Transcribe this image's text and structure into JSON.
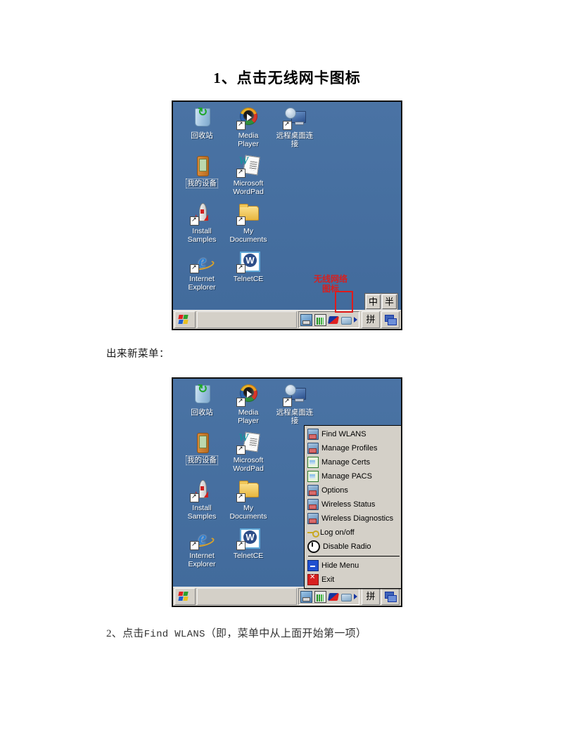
{
  "document": {
    "title": "1、点击无线网卡图标",
    "para_after_first": "出来新菜单：",
    "para_bottom_prefix": "2、点击",
    "para_bottom_mono": "Find WLANS",
    "para_bottom_suffix": "（即，菜单中从上面开始第一项）"
  },
  "colors": {
    "desktop_blue": "#46709f",
    "taskbar_gray": "#d4d0c8",
    "annotation_red": "#d71f1f",
    "menu_bg": "#d4d0c8"
  },
  "desktop": {
    "icons": [
      {
        "label": "回收站",
        "icon": "recycle-bin-icon",
        "shortcut": false,
        "selected": false
      },
      {
        "label": "Media\nPlayer",
        "icon": "media-player-icon",
        "shortcut": true,
        "selected": false
      },
      {
        "label": "远程桌面连\n接",
        "icon": "remote-desktop-icon",
        "shortcut": true,
        "selected": false
      },
      {
        "label": "我的设备",
        "icon": "my-device-icon",
        "shortcut": false,
        "selected": true
      },
      {
        "label": "Microsoft\nWordPad",
        "icon": "wordpad-icon",
        "shortcut": true,
        "selected": false
      },
      {
        "label": "Install\nSamples",
        "icon": "install-samples-icon",
        "shortcut": true,
        "selected": false
      },
      {
        "label": "My\nDocuments",
        "icon": "my-documents-icon",
        "shortcut": true,
        "selected": false
      },
      {
        "label": "Internet\nExplorer",
        "icon": "internet-explorer-icon",
        "shortcut": true,
        "selected": false
      },
      {
        "label": "TelnetCE",
        "icon": "telnetce-icon",
        "shortcut": true,
        "selected": false
      }
    ]
  },
  "annotation": {
    "text": "无线网络\n图标"
  },
  "ime_float": {
    "keys": [
      "中",
      "半"
    ]
  },
  "taskbar": {
    "start_button": "start-button",
    "tray_icons": [
      "network-icon",
      "signal-bars-icon",
      "wireless-icon",
      "connection-icon"
    ],
    "tray_overflow": "▶",
    "ime_label": "拼",
    "switch_label": "task-switch-icon"
  },
  "context_menu": {
    "items": [
      {
        "label": "Find WLANS",
        "icon": "find-wlans-icon",
        "type": "item"
      },
      {
        "label": "Manage Profiles",
        "icon": "manage-profiles-icon",
        "type": "item"
      },
      {
        "label": "Manage Certs",
        "icon": "manage-certs-icon",
        "type": "item"
      },
      {
        "label": "Manage PACS",
        "icon": "manage-pacs-icon",
        "type": "item"
      },
      {
        "label": "Options",
        "icon": "options-icon",
        "type": "item"
      },
      {
        "label": "Wireless Status",
        "icon": "wireless-status-icon",
        "type": "item"
      },
      {
        "label": "Wireless Diagnostics",
        "icon": "wireless-diagnostics-icon",
        "type": "item"
      },
      {
        "label": "Log on/off",
        "icon": "key-icon",
        "type": "item"
      },
      {
        "label": "Disable Radio",
        "icon": "power-icon",
        "type": "item"
      },
      {
        "label": "",
        "icon": "",
        "type": "separator"
      },
      {
        "label": "Hide Menu",
        "icon": "hide-menu-icon",
        "type": "item"
      },
      {
        "label": "Exit",
        "icon": "exit-icon",
        "type": "item"
      }
    ]
  }
}
